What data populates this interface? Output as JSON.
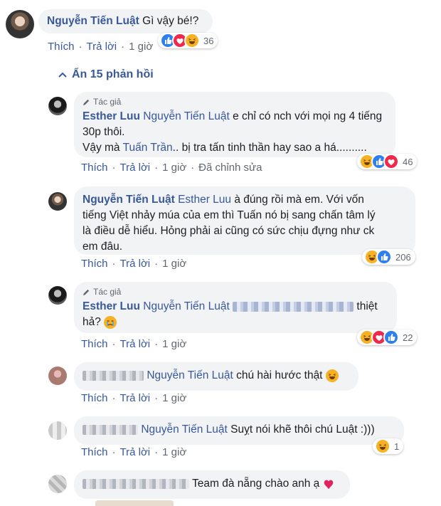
{
  "top_comment": {
    "author": "Nguyễn Tiến Luật",
    "text": "Gì vậy bé!?",
    "actions": {
      "like": "Thích",
      "reply": "Trả lời",
      "time": "1 giờ"
    },
    "reaction_count": "36",
    "reactions": [
      "like-icon",
      "love-icon",
      "haha-icon"
    ]
  },
  "hide_replies_label": "Ẩn 15 phản hồi",
  "replies": [
    {
      "author_badge": "Tác giả",
      "author": "Esther Luu",
      "mention": "Nguyễn Tiến Luật",
      "text_line1": " e chỉ có nch với mọi ng 4 tiếng",
      "text_line2": "30p thôi.",
      "text_line3_pre": "Vậy mà ",
      "text_line3_tag": "Tuấn Trần",
      "text_line3_post": ".. bị tra tấn tinh thần hay sao a há..........",
      "actions": {
        "like": "Thích",
        "reply": "Trả lời",
        "time": "1 giờ",
        "edited": "Đã chỉnh sửa"
      },
      "reaction_count": "46",
      "reactions": [
        "haha-icon",
        "like-icon",
        "love-icon"
      ]
    },
    {
      "author": "Nguyễn Tiến Luật",
      "mention": "Esther Luu",
      "text_line1": " à đúng rồi mà em. Với vốn",
      "text_line2": "tiếng Việt nhảy múa của em thì Tuấn nó bị sang chấn tâm lý",
      "text_line3": "là điều dễ hiểu. Hỏng phải ai cũng có sức chịu đựng như ck",
      "text_line4": "em đâu.",
      "actions": {
        "like": "Thích",
        "reply": "Trả lời",
        "time": "1 giờ"
      },
      "reaction_count": "206",
      "reactions": [
        "haha-icon",
        "like-icon"
      ]
    },
    {
      "author_badge": "Tác giả",
      "author": "Esther Luu",
      "mention": "Nguyễn Tiến Luật",
      "text_tail": "thiệt",
      "text_line2": "hả?",
      "actions": {
        "like": "Thích",
        "reply": "Trả lời",
        "time": "1 giờ"
      },
      "reaction_count": "22",
      "reactions": [
        "haha-icon",
        "love-icon",
        "like-icon"
      ]
    },
    {
      "mention": "Nguyễn Tiến Luật",
      "text": " chú hài hước thật ",
      "actions": {
        "like": "Thích",
        "reply": "Trả lời",
        "time": "1 giờ"
      }
    },
    {
      "mention": "Nguyễn Tiến Luật",
      "text": " Suỵt nói khẽ thôi chú Luật :)))",
      "actions": {
        "like": "Thích",
        "reply": "Trả lời",
        "time": "1 giờ"
      },
      "reaction_count": "1",
      "reactions": [
        "haha-icon"
      ]
    },
    {
      "text": " Team đà nẵng chào anh ạ"
    }
  ],
  "colors": {
    "link": "#385898",
    "bubble": "#f2f3f5",
    "meta": "#606770"
  }
}
